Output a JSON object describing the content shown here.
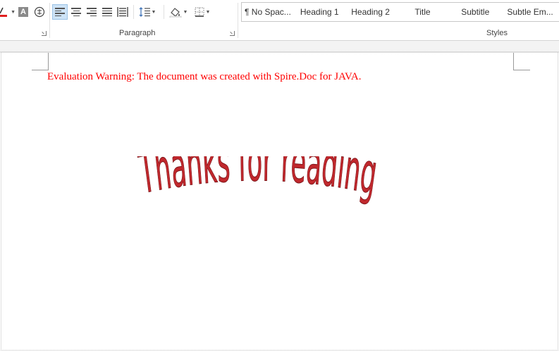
{
  "ribbon": {
    "groups": {
      "paragraph_label": "Paragraph",
      "styles_label": "Styles"
    },
    "styles": [
      "¶ No Spac...",
      "Heading 1",
      "Heading 2",
      "Title",
      "Subtitle",
      "Subtle Em..."
    ],
    "highlight_glyph": "A",
    "accent_color": "#cde3f7"
  },
  "document": {
    "warning_text": "Evaluation Warning: The document was created with Spire.Doc for JAVA.",
    "warning_color": "#ff0000",
    "wordart_text": "Thanks for reading",
    "wordart_color": "#c0282d"
  }
}
